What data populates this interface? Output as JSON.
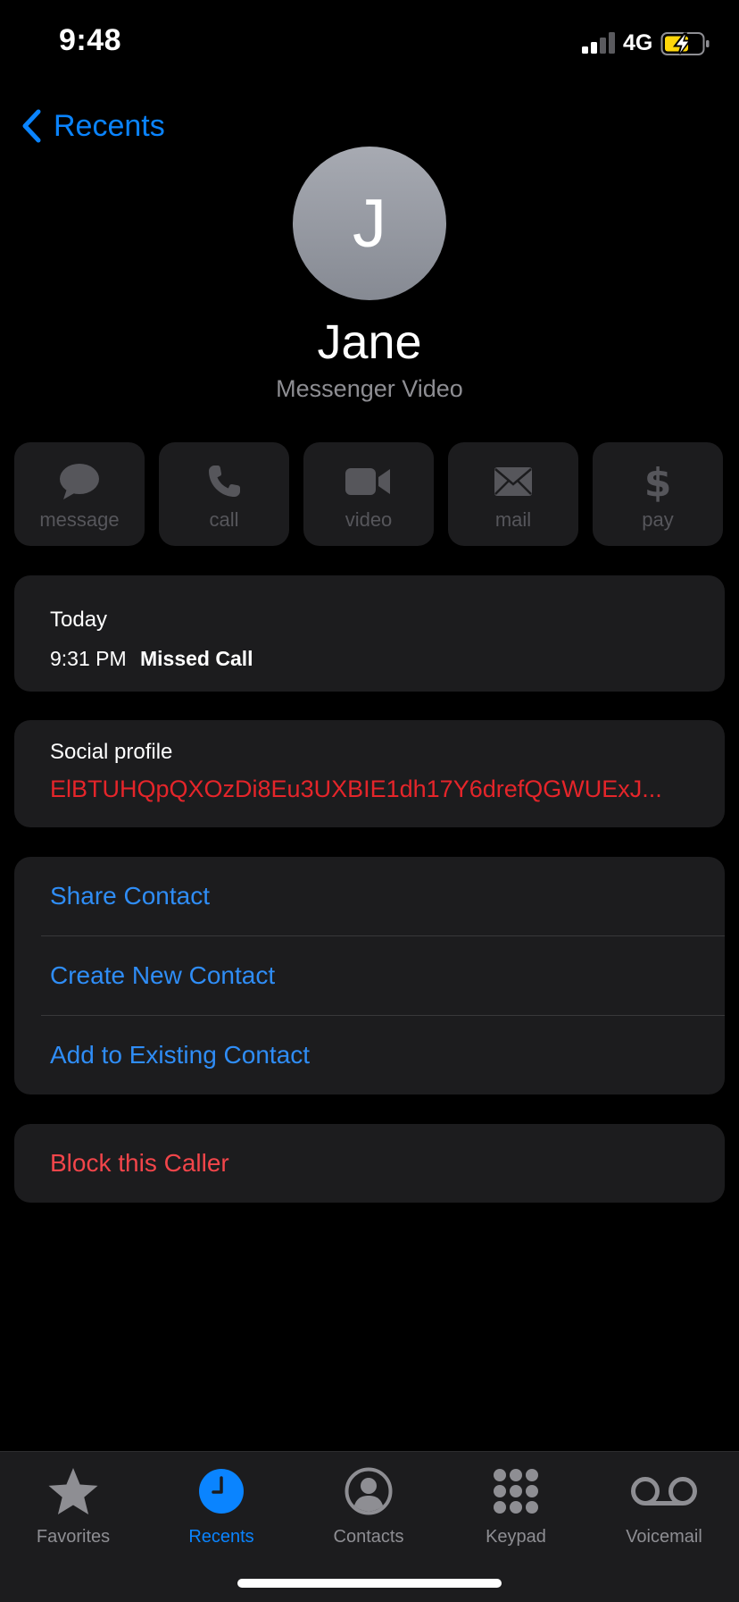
{
  "status_bar": {
    "time": "9:48",
    "network": "4G",
    "battery_state": "charging",
    "battery_color": "#ffd60a"
  },
  "nav": {
    "back_label": "Recents",
    "back_icon": "chevron-left-icon"
  },
  "contact": {
    "initial": "J",
    "name": "Jane",
    "subtitle": "Messenger Video"
  },
  "actions": [
    {
      "label": "message",
      "icon": "message-bubble-icon"
    },
    {
      "label": "call",
      "icon": "phone-icon"
    },
    {
      "label": "video",
      "icon": "video-camera-icon"
    },
    {
      "label": "mail",
      "icon": "envelope-icon"
    },
    {
      "label": "pay",
      "icon": "dollar-icon"
    }
  ],
  "call_log": {
    "day": "Today",
    "entries": [
      {
        "time": "9:31 PM",
        "status": "Missed Call"
      }
    ]
  },
  "social": {
    "label": "Social profile",
    "value": "ElBTUHQpQXOzDi8Eu3UXBIE1dh17Y6drefQGWUExJ..."
  },
  "options": {
    "share": "Share Contact",
    "create": "Create New Contact",
    "add_existing": "Add to Existing Contact"
  },
  "block": {
    "label": "Block this Caller"
  },
  "tabs": [
    {
      "label": "Favorites",
      "icon": "star-icon",
      "active": false
    },
    {
      "label": "Recents",
      "icon": "clock-icon",
      "active": true
    },
    {
      "label": "Contacts",
      "icon": "person-circle-icon",
      "active": false
    },
    {
      "label": "Keypad",
      "icon": "keypad-icon",
      "active": false
    },
    {
      "label": "Voicemail",
      "icon": "voicemail-icon",
      "active": false
    }
  ],
  "colors": {
    "accent": "#0a84ff",
    "link": "#2f8df6",
    "destructive": "#f2454a",
    "social_value": "#e5252a",
    "card": "#1c1c1e",
    "background": "#000000"
  }
}
